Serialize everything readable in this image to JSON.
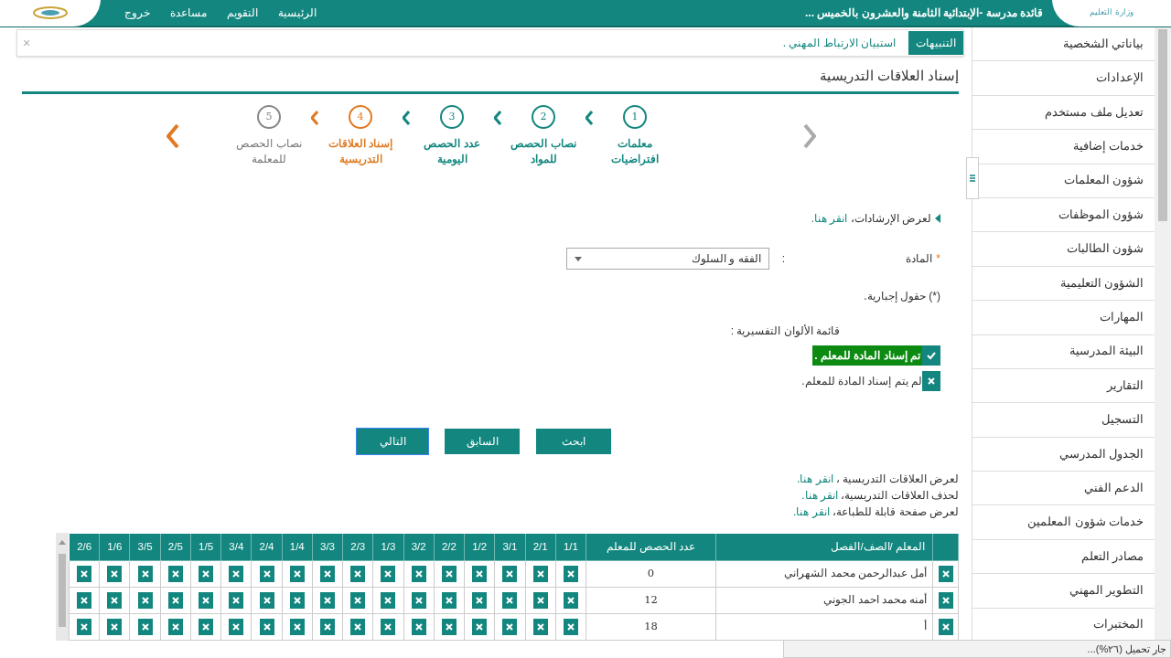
{
  "header": {
    "ministry": "وزارة التعليم",
    "title": "قائدة مدرسة -الإبتدائية الثامنة والعشرون بالخميس ...",
    "nav": [
      "الرئيسية",
      "التقويم",
      "مساعدة",
      "خروج"
    ]
  },
  "alerts": {
    "label": "التنبيهات",
    "message": "استبيان الارتباط المهني .",
    "close": "×"
  },
  "page_title": "إسناد العلاقات التدريسية",
  "steps": [
    {
      "number": "1",
      "label": "معلمات افتراضيات",
      "completed": true,
      "selected": false
    },
    {
      "number": "2",
      "label": "نصاب الحصص للمواد",
      "completed": true,
      "selected": false
    },
    {
      "number": "3",
      "label": "عدد الحصص اليومية",
      "completed": true,
      "selected": false
    },
    {
      "number": "4",
      "label": "إسناد العلاقات التدريسية",
      "completed": false,
      "selected": true
    },
    {
      "number": "5",
      "label": "نصاب الحصص للمعلمة",
      "completed": false,
      "selected": false
    }
  ],
  "guide": {
    "text": "لعرض الإرشادات،",
    "link": "انقر هنا."
  },
  "subject": {
    "required_mark": "*",
    "label": "المادة",
    "colon": ":",
    "value": "الفقه و السلوك"
  },
  "required_note": "(*) حقول إجبارية.",
  "legend": {
    "title": "قائمة الألوان التفسيرية :",
    "items": [
      {
        "assigned": true,
        "text": "تم إسناد المادة للمعلم ."
      },
      {
        "assigned": false,
        "text": "لم يتم إسناد المادة للمعلم."
      }
    ]
  },
  "buttons": [
    "ابحث",
    "السابق",
    "التالي"
  ],
  "links": [
    {
      "text": "لعرض العلاقات التدريسية ،",
      "link": "انقر هنا."
    },
    {
      "text": "لحذف العلاقات التدريسية،",
      "link": "انقر هنا."
    },
    {
      "text": "لعرض صفحة قابلة للطباعة،",
      "link": "انقر هنا."
    }
  ],
  "table": {
    "columns": [
      "المعلم /الصف/الفصل",
      "عدد الحصص للمعلم",
      "1/1",
      "2/1",
      "3/1",
      "1/2",
      "2/2",
      "3/2",
      "1/3",
      "2/3",
      "3/3",
      "1/4",
      "2/4",
      "3/4",
      "1/5",
      "2/5",
      "3/5",
      "1/6",
      "2/6"
    ],
    "rows": [
      {
        "selected": false,
        "name": "أمل عبدالرحمن محمد الشهراني",
        "count": "0",
        "assigned": [
          false,
          false,
          false,
          false,
          false,
          false,
          false,
          false,
          false,
          false,
          false,
          false,
          false,
          false,
          false,
          false,
          false
        ]
      },
      {
        "selected": false,
        "name": "أمنه محمد احمد الجوني",
        "count": "12",
        "assigned": [
          false,
          false,
          false,
          false,
          false,
          false,
          false,
          false,
          false,
          false,
          false,
          false,
          false,
          false,
          false,
          false,
          false
        ]
      },
      {
        "selected": false,
        "name": "أ",
        "count": "18",
        "assigned": [
          false,
          false,
          false,
          false,
          false,
          false,
          false,
          false,
          false,
          false,
          false,
          false,
          false,
          false,
          false,
          false,
          false
        ]
      }
    ]
  },
  "sidebar": {
    "items": [
      "بياناتي الشخصية",
      "الإعدادات",
      "تعديل ملف مستخدم",
      "خدمات إضافية",
      "شؤون المعلمات",
      "شؤون الموظفات",
      "شؤون الطالبات",
      "الشؤون التعليمية",
      "المهارات",
      "البيئة المدرسية",
      "التقارير",
      "التسجيل",
      "الجدول المدرسي",
      "الدعم الفني",
      "خدمات شؤون المعلمين",
      "مصادر التعلم",
      "التطوير المهني",
      "المختبرات"
    ]
  },
  "status_bar": "جار تحميل (٢٦%)..."
}
